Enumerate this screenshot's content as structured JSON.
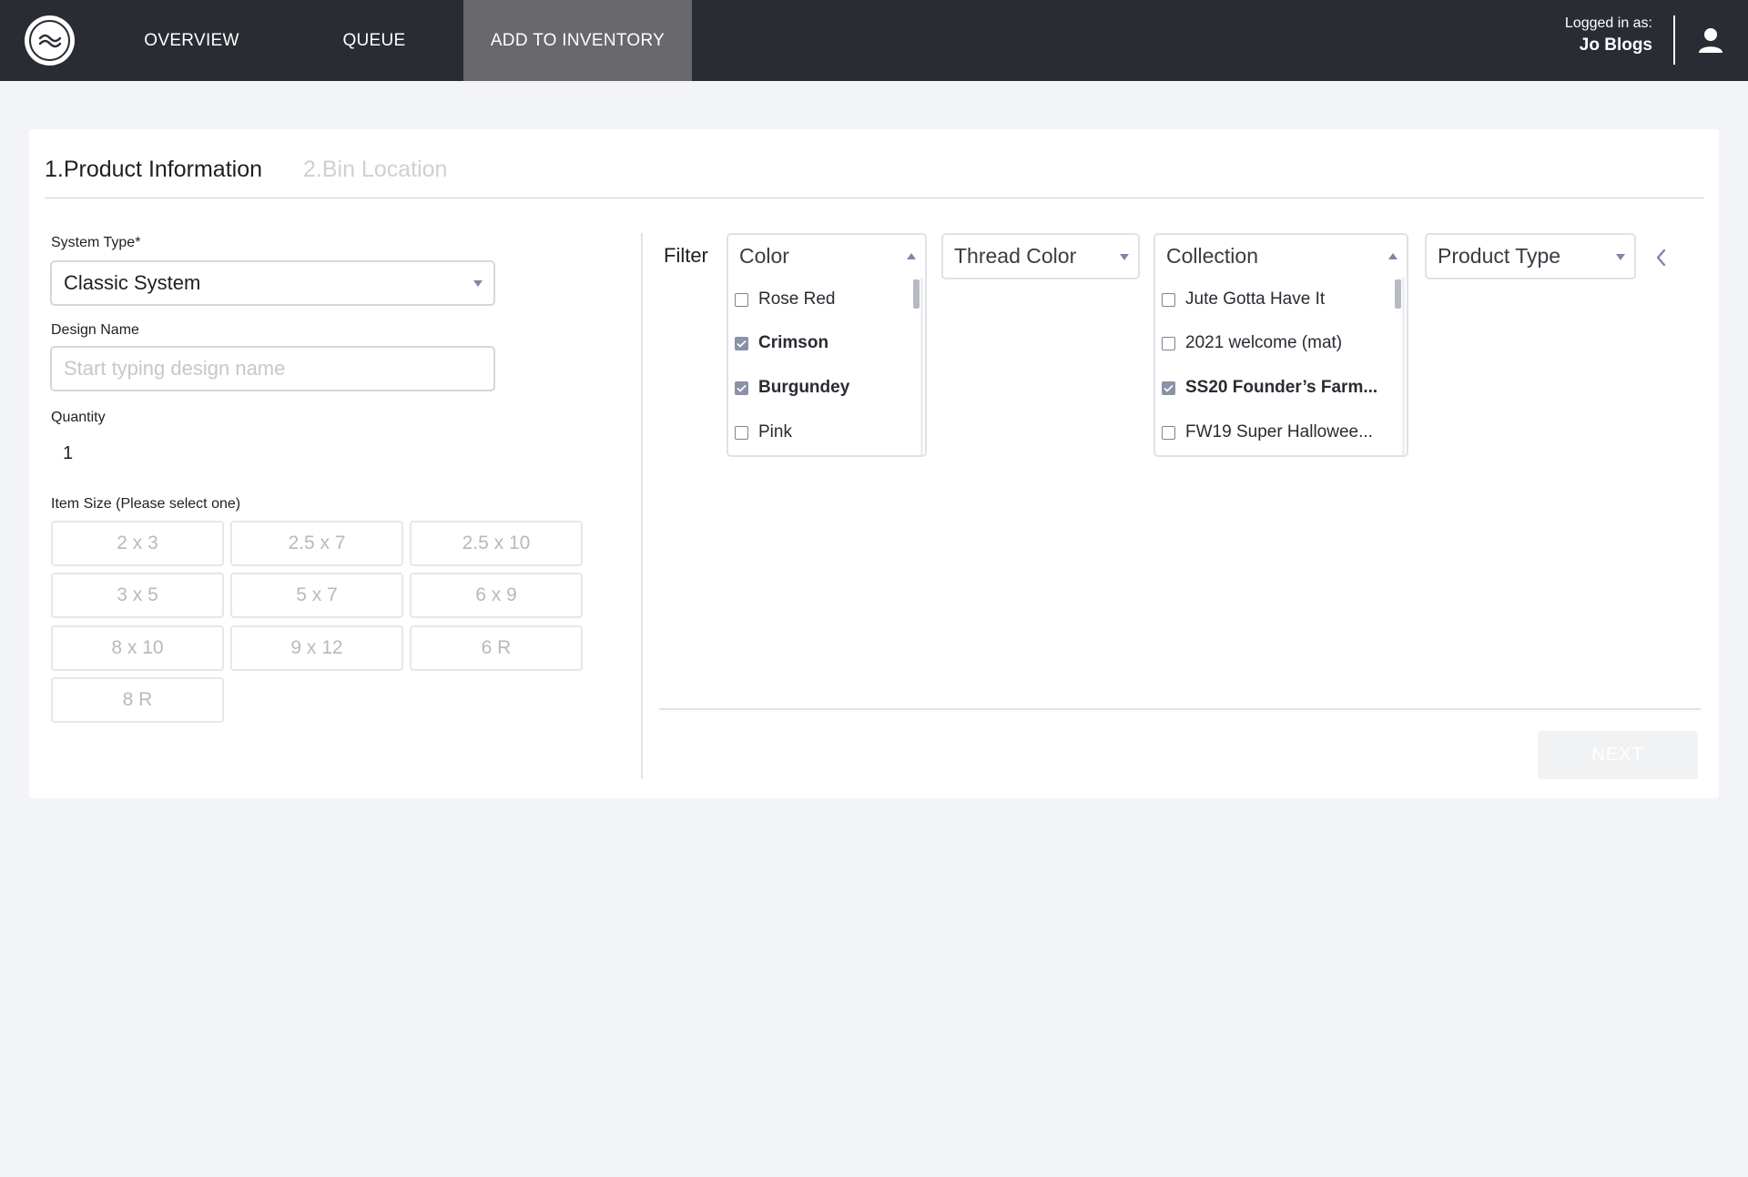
{
  "nav": {
    "items": [
      {
        "label": "OVERVIEW"
      },
      {
        "label": "QUEUE"
      },
      {
        "label": "ADD TO INVENTORY"
      }
    ],
    "active": "ADD TO INVENTORY"
  },
  "user": {
    "logged_in_label": "Logged in as:",
    "name": "Jo Blogs"
  },
  "steps": [
    {
      "label": "1.Product Information",
      "active": true
    },
    {
      "label": "2.Bin Location",
      "active": false
    }
  ],
  "form": {
    "system_type_label": "System Type*",
    "system_type_value": "Classic System",
    "design_name_label": "Design Name",
    "design_name_placeholder": "Start typing design name",
    "design_name_value": "",
    "quantity_label": "Quantity",
    "quantity_value": "1",
    "item_size_label": "Item Size (Please select one)",
    "sizes": [
      "2 x 3",
      "2.5 x 7",
      "2.5 x 10",
      "3 x 5",
      "5 x 7",
      "6 x 9",
      "8 x 10",
      "9 x 12",
      "6 R",
      "8 R"
    ]
  },
  "filter": {
    "label": "Filter",
    "dropdowns": {
      "color": {
        "label": "Color",
        "open": true,
        "options": [
          {
            "label": "Rose Red",
            "checked": false
          },
          {
            "label": "Crimson",
            "checked": true
          },
          {
            "label": "Burgundey",
            "checked": true
          },
          {
            "label": "Pink",
            "checked": false
          }
        ]
      },
      "thread_color": {
        "label": "Thread Color",
        "open": false
      },
      "collection": {
        "label": "Collection",
        "open": true,
        "options": [
          {
            "label": "Jute Gotta Have It",
            "checked": false
          },
          {
            "label": "2021 welcome (mat)",
            "checked": false
          },
          {
            "label": "SS20 Founder’s Farm...",
            "checked": true
          },
          {
            "label": "FW19 Super Hallowee...",
            "checked": false
          }
        ]
      },
      "product_type": {
        "label": "Product Type",
        "open": false
      }
    }
  },
  "actions": {
    "next_label": "NEXT",
    "next_enabled": false
  },
  "colors": {
    "topbar": "#2a2c33",
    "active_nav": "#68686d",
    "background": "#f3f4f7",
    "checkbox_checked": "#8b91a6"
  },
  "icons": {
    "logo": "wave-logo-icon",
    "user": "user-icon",
    "collapse": "chevron-left-icon"
  }
}
